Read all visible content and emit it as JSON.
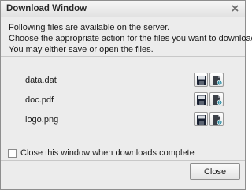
{
  "window": {
    "title": "Download Window",
    "close_icon": "close-icon"
  },
  "intro": {
    "lines": [
      "Following files are available on the server.",
      "Choose the appropriate action for the files you want to download.",
      "You may either save or open the files."
    ]
  },
  "files": [
    {
      "name": "data.dat",
      "save_icon": "floppy-disk-icon",
      "open_icon": "open-file-icon"
    },
    {
      "name": "doc.pdf",
      "save_icon": "floppy-disk-icon",
      "open_icon": "open-file-icon"
    },
    {
      "name": "logo.png",
      "save_icon": "floppy-disk-icon",
      "open_icon": "open-file-icon"
    }
  ],
  "options": {
    "close_when_complete_label": "Close this window when downloads complete",
    "close_when_complete_checked": false
  },
  "footer": {
    "close_label": "Close"
  },
  "colors": {
    "save_icon": "#1a2233",
    "open_icon_teal": "#2a8aa0"
  }
}
